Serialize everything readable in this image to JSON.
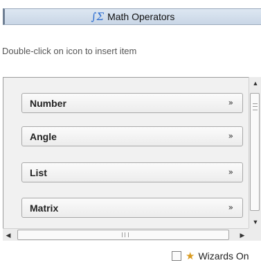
{
  "panel": {
    "title": "Math Operators",
    "title_icon": "∫Σ",
    "hint": "Double-click on icon to insert item"
  },
  "categories": [
    {
      "label": "Number"
    },
    {
      "label": "Angle"
    },
    {
      "label": "List"
    },
    {
      "label": "Matrix"
    }
  ],
  "icons": {
    "expand": "»",
    "up": "▲",
    "down": "▼",
    "left": "◀",
    "right": "▶"
  },
  "footer": {
    "wizards_label": "Wizards On",
    "wizards_checked": false,
    "wand_icon": "🔑"
  }
}
